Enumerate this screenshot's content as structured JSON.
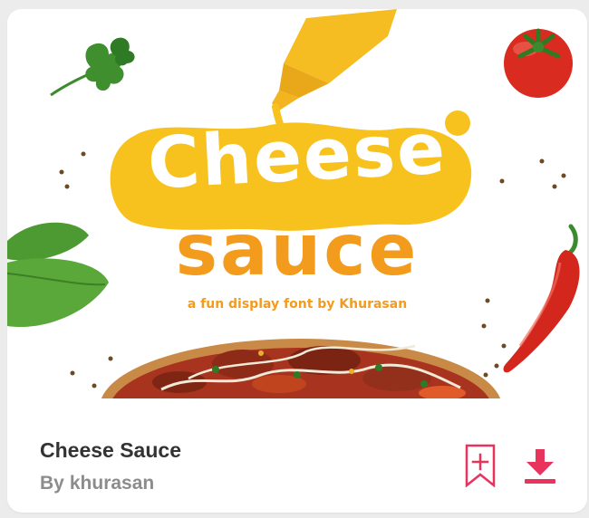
{
  "preview": {
    "headline_line1": "Cheese",
    "headline_line2": "sauce",
    "tagline": "a fun display font by Khurasan"
  },
  "font_card": {
    "title": "Cheese Sauce",
    "author_prefix": "By",
    "author_name": "khurasan",
    "actions": {
      "bookmark_icon": "bookmark-plus-icon",
      "download_icon": "download-icon"
    }
  },
  "colors": {
    "accent": "#e8335d",
    "cheese_yellow": "#f7c21d",
    "sauce_orange": "#f39b1d",
    "title_text": "#333333",
    "author_text": "#8c8c8c"
  }
}
